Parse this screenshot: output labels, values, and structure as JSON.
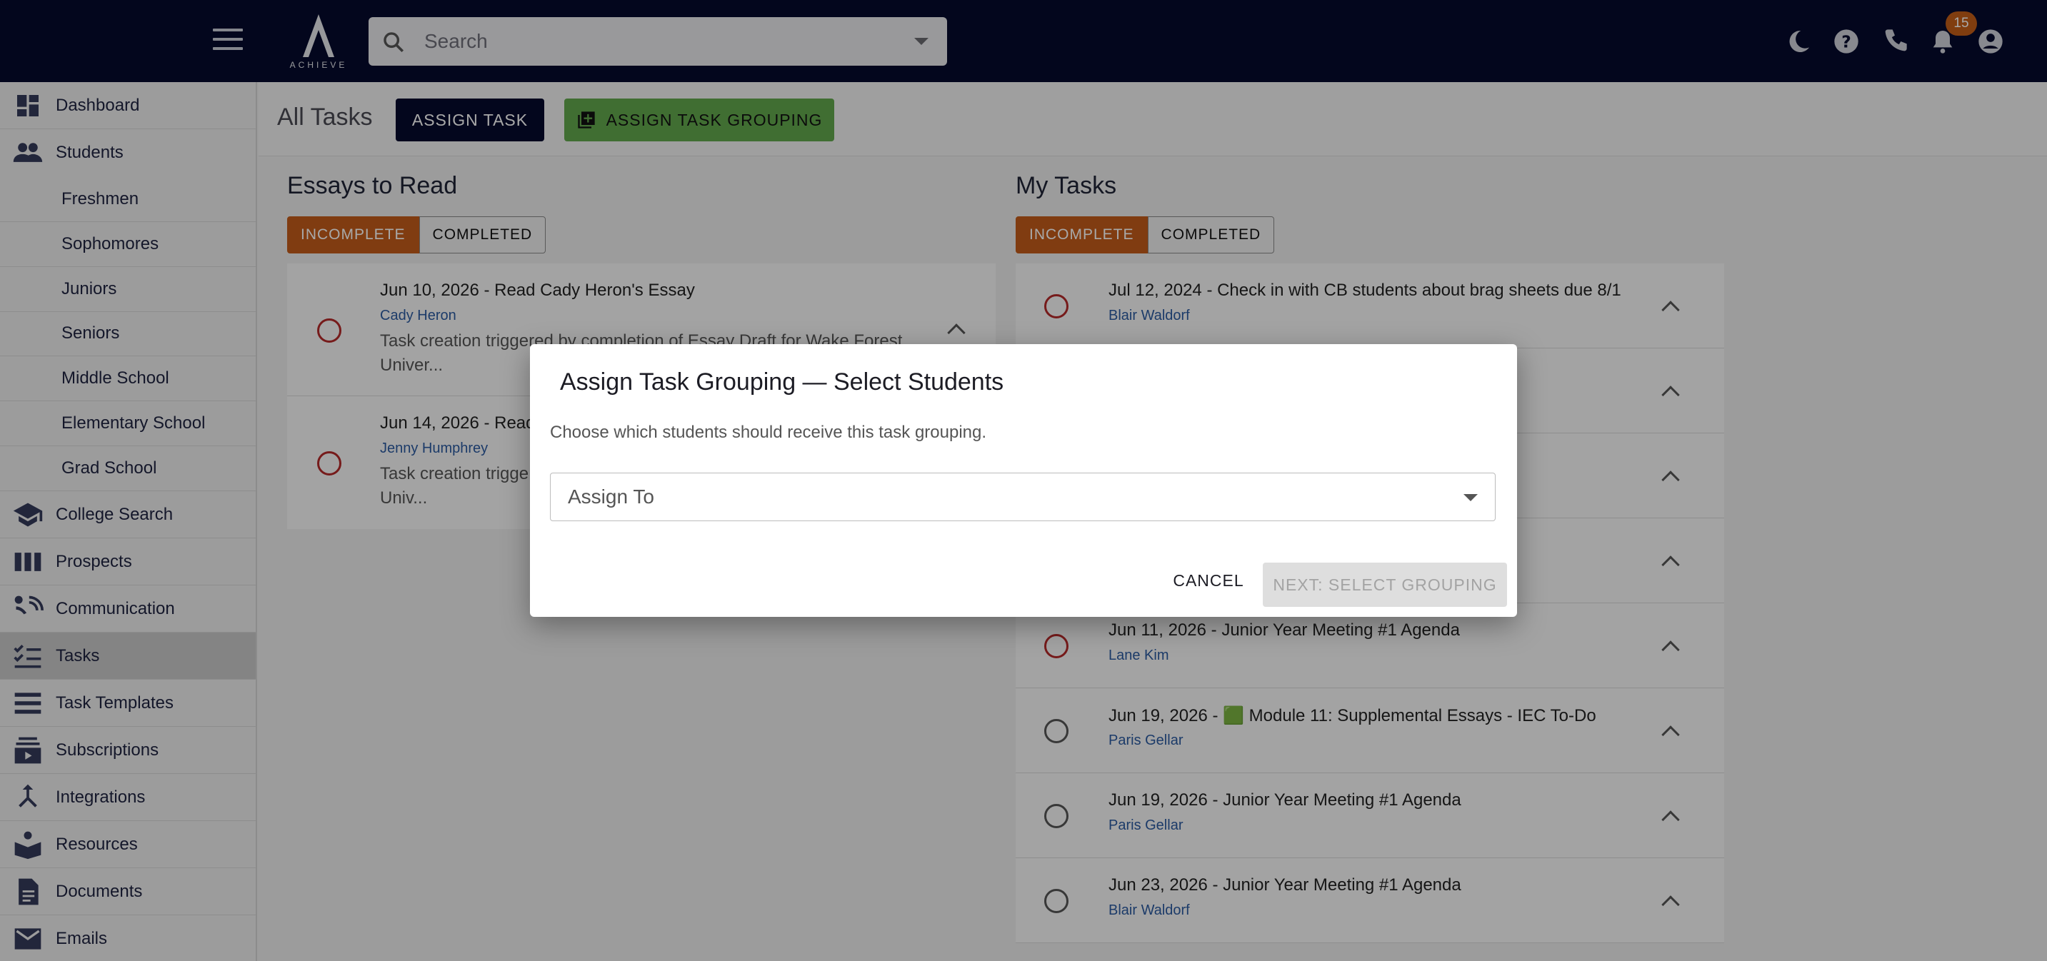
{
  "topbar": {
    "logo_text": "ACHIEVE",
    "search_placeholder": "Search",
    "notification_count": "15"
  },
  "sidebar": {
    "items": [
      {
        "label": "Dashboard",
        "icon": "dashboard-icon"
      },
      {
        "label": "Students",
        "icon": "people-icon"
      },
      {
        "label": "Freshmen"
      },
      {
        "label": "Sophomores"
      },
      {
        "label": "Juniors"
      },
      {
        "label": "Seniors"
      },
      {
        "label": "Middle School"
      },
      {
        "label": "Elementary School"
      },
      {
        "label": "Grad School"
      },
      {
        "label": "College Search",
        "icon": "school-icon"
      },
      {
        "label": "Prospects",
        "icon": "columns-icon"
      },
      {
        "label": "Communication",
        "icon": "communication-icon"
      },
      {
        "label": "Tasks",
        "icon": "checklist-icon",
        "active": true
      },
      {
        "label": "Task Templates",
        "icon": "list-icon"
      },
      {
        "label": "Subscriptions",
        "icon": "subscriptions-icon"
      },
      {
        "label": "Integrations",
        "icon": "merge-icon"
      },
      {
        "label": "Resources",
        "icon": "book-icon"
      },
      {
        "label": "Documents",
        "icon": "document-icon"
      },
      {
        "label": "Emails",
        "icon": "mail-icon"
      }
    ]
  },
  "header": {
    "title": "All Tasks",
    "assign_task": "ASSIGN TASK",
    "assign_task_grouping": "ASSIGN TASK GROUPING"
  },
  "essays": {
    "title": "Essays to Read",
    "toggle_incomplete": "INCOMPLETE",
    "toggle_completed": "COMPLETED",
    "items": [
      {
        "title": "Jun 10, 2026 - Read Cady Heron's Essay",
        "name": "Cady Heron",
        "desc": "Task creation triggered by completion of Essay Draft for Wake Forest Univer..."
      },
      {
        "title": "Jun 14, 2026 - Read",
        "name": "Jenny Humphrey",
        "desc": "Task creation trigge Univ..."
      }
    ]
  },
  "mytasks": {
    "title": "My Tasks",
    "toggle_incomplete": "INCOMPLETE",
    "toggle_completed": "COMPLETED",
    "items": [
      {
        "title": "Jul 12, 2024 - Check in with CB students about brag sheets due 8/1",
        "name": "Blair Waldorf",
        "overdue": true
      },
      {
        "title": "",
        "name": ""
      },
      {
        "title": "",
        "name": ""
      },
      {
        "title": "",
        "name": ""
      },
      {
        "title": "Jun 11, 2026 - Junior Year Meeting #1 Agenda",
        "name": "Lane Kim",
        "overdue": true
      },
      {
        "title": "Jun 19, 2026 - 🟩 Module 11: Supplemental Essays - IEC To-Do",
        "name": "Paris Gellar",
        "overdue": false
      },
      {
        "title": "Jun 19, 2026 - Junior Year Meeting #1 Agenda",
        "name": "Paris Gellar",
        "overdue": false
      },
      {
        "title": "Jun 23, 2026 - Junior Year Meeting #1 Agenda",
        "name": "Blair Waldorf",
        "overdue": false
      }
    ]
  },
  "dialog": {
    "title": "Assign Task Grouping — Select Students",
    "subtitle": "Choose which students should receive this task grouping.",
    "select_placeholder": "Assign To",
    "cancel": "CANCEL",
    "next": "NEXT: SELECT GROUPING"
  }
}
